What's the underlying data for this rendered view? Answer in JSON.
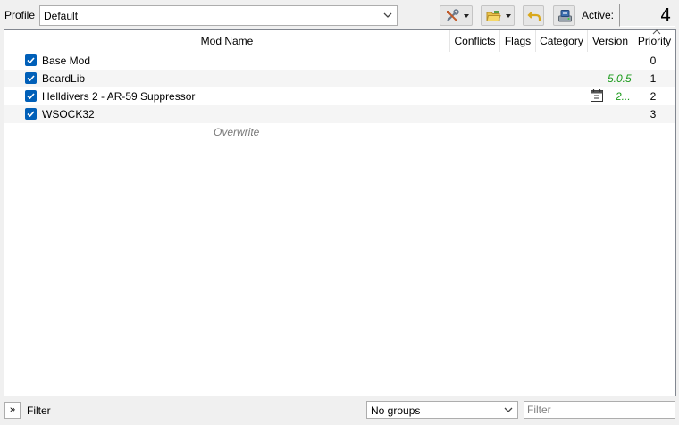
{
  "toolbar": {
    "profile_label": "Profile",
    "profile_value": "Default",
    "active_label": "Active:",
    "active_count": "4"
  },
  "modlist": {
    "columns": [
      "Mod Name",
      "Conflicts",
      "Flags",
      "Category",
      "Version",
      "Priority"
    ],
    "rows": [
      {
        "name": "Base Mod",
        "version": "",
        "priority": "0"
      },
      {
        "name": "BeardLib",
        "version": "5.0.5",
        "priority": "1"
      },
      {
        "name": "Helldivers 2 - AR-59 Suppressor",
        "version": "2...",
        "priority": "2"
      },
      {
        "name": "WSOCK32",
        "version": "",
        "priority": "3"
      }
    ],
    "overwrite_label": "Overwrite"
  },
  "bottombar": {
    "expand_label": "»",
    "filter_label": "Filter",
    "groups_value": "No groups",
    "filter_placeholder": "Filter"
  }
}
